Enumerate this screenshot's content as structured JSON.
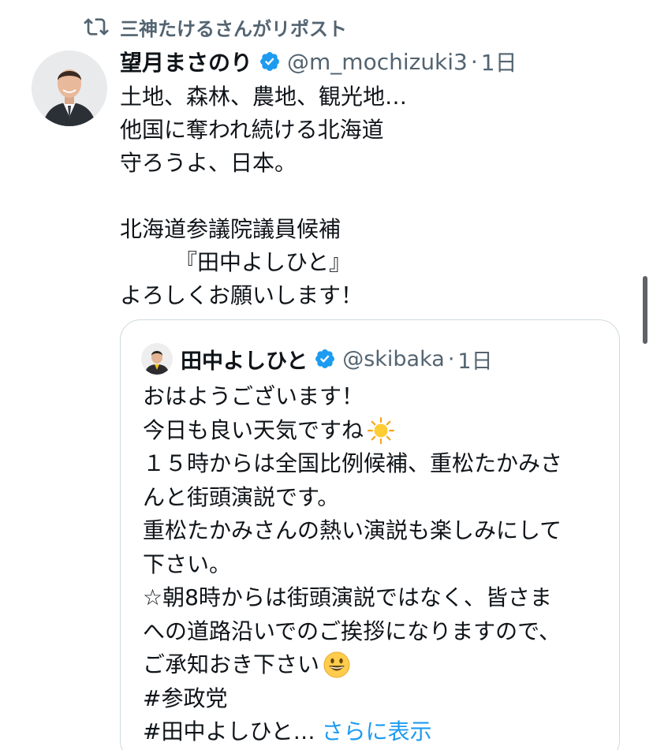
{
  "repost": {
    "label": "三神たけるさんがリポスト",
    "icon": "repost-icon"
  },
  "tweet": {
    "display_name": "望月まさのり",
    "handle": "@m_mochizuki3",
    "separator": "·",
    "time": "1日",
    "verified_color": "#1d9bf0",
    "lines": [
      "土地、森林、農地、観光地…",
      "他国に奪われ続ける北海道",
      "守ろうよ、日本。",
      "",
      "北海道参議院議員候補",
      "『田中よしひと』",
      "よろしくお願いします！"
    ]
  },
  "quote": {
    "display_name": "田中よしひと",
    "handle": "@skibaka",
    "separator": "·",
    "time": "1日",
    "lines": [
      "おはようございます！",
      "今日も良い天気ですね",
      "１５時からは全国比例候補、重松たかみさ",
      "んと街頭演説です。",
      "重松たかみさんの熱い演説も楽しみにして",
      "下さい。",
      "☆朝8時からは街頭演説ではなく、皆さま",
      "への道路沿いでのご挨拶になりますので、",
      "ご承知おき下さい",
      "#参政党",
      "#田中よしひと…"
    ],
    "show_more": "さらに表示",
    "emoji_sun": "sun-emoji",
    "emoji_smile": "smile-emoji"
  },
  "colors": {
    "text": "#0f1419",
    "secondary": "#536471",
    "link": "#1d9bf0",
    "border": "#cfd9de"
  }
}
